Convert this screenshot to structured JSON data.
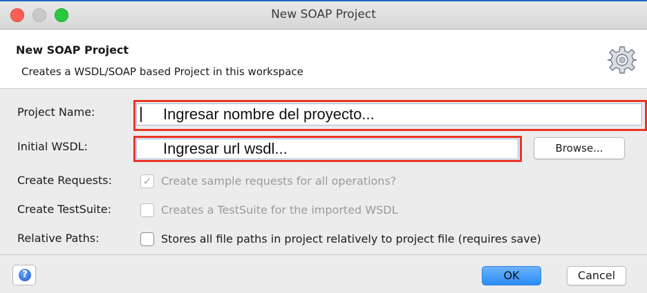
{
  "window": {
    "title": "New SOAP Project"
  },
  "header": {
    "title": "New SOAP Project",
    "description": "Creates a WSDL/SOAP based Project in this workspace",
    "icon": "gear-icon"
  },
  "form": {
    "project_name": {
      "label": "Project Name:",
      "value": "Ingresar nombre del proyecto..."
    },
    "initial_wsdl": {
      "label": "Initial WSDL:",
      "value": "Ingresar url wsdl...",
      "browse_label": "Browse..."
    },
    "create_requests": {
      "label": "Create Requests:",
      "text": "Create sample requests for all operations?",
      "checked": true,
      "enabled": false
    },
    "create_testsuite": {
      "label": "Create TestSuite:",
      "text": "Creates a TestSuite for the imported WSDL",
      "checked": false,
      "enabled": false
    },
    "relative_paths": {
      "label": "Relative Paths:",
      "text": "Stores all file paths in project relatively to project file (requires save)",
      "checked": false,
      "enabled": true
    }
  },
  "footer": {
    "help_icon": "help-icon",
    "ok_label": "OK",
    "cancel_label": "Cancel"
  },
  "colors": {
    "highlight": "#ea3323",
    "accent": "#2a8cf7",
    "close": "#fe5f57",
    "maximize": "#28c840"
  }
}
